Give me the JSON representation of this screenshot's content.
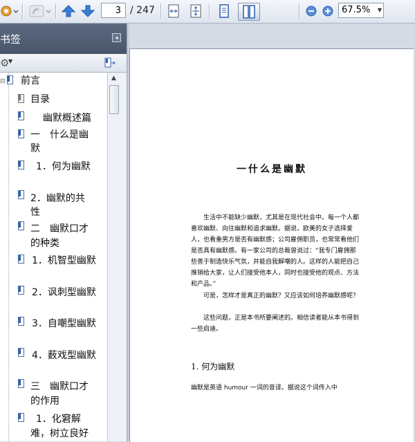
{
  "toolbar": {
    "current_page": "3",
    "total_pages": "/ 247",
    "zoom_level": "67.5%",
    "icons": [
      "app-menu-icon",
      "hand-tool-icon",
      "page-up-icon",
      "page-down-icon",
      "fit-width-icon",
      "fit-page-icon",
      "single-page-view-icon",
      "two-page-view-icon",
      "zoom-out-icon",
      "zoom-in-icon"
    ]
  },
  "sidebar": {
    "title": "书签",
    "items": [
      {
        "label": "前言",
        "icon": "bookmark-icon"
      },
      {
        "label": "目录",
        "icon": "bookmark-gray-icon"
      },
      {
        "label": "幽默概述篇",
        "icon": "bookmark-icon"
      },
      {
        "label": "一　什么是幽",
        "label2": "默",
        "icon": "bookmark-icon"
      },
      {
        "label": "1．何为幽默",
        "icon": "bookmark-icon"
      },
      {
        "label": "2．幽默的共",
        "label2": "性",
        "icon": "bookmark-icon"
      },
      {
        "label": "二　幽默口才",
        "label2": "的种类",
        "icon": "bookmark-icon"
      },
      {
        "label": "1．机智型幽默",
        "icon": "bookmark-icon"
      },
      {
        "label": "2．讽刺型幽默",
        "icon": "bookmark-icon"
      },
      {
        "label": "3．自嘲型幽默",
        "icon": "bookmark-icon"
      },
      {
        "label": "4．薮戏型幽默",
        "icon": "bookmark-icon"
      },
      {
        "label": "三　幽默口才",
        "label2": "的作用",
        "icon": "bookmark-icon"
      },
      {
        "label": "1．化窘解",
        "label2": "难，树立良好",
        "icon": "bookmark-icon"
      }
    ]
  },
  "document": {
    "page_title": "一什么是幽默",
    "p1": "生活中不能缺少幽默，尤其是在现代社会中。每一个人都喜欢幽默、向往幽默和追求幽默。据说，欧美的女子选择爱人，也看重男方是否有幽默感；公司雇佣职员，也常常看他们是否具有幽默感。有一家公司的总裁曾说过：“我专门雇佣那些善于制造快乐气氛，并能自我解嘲的人。这样的人能把自己推销给大家，让人们接受他本人，同时也接受他的观点、方法和产品。”",
    "p2": "可是，怎样才是真正的幽默？又应该如何培养幽默感呢？",
    "p3": "这些问题，正是本书所要阐述的。相信读者能从本书得到一些启迪。",
    "section_heading": "1. 何为幽默",
    "p4": "幽默是英语 humour 一词的音译。据说这个词传入中"
  }
}
